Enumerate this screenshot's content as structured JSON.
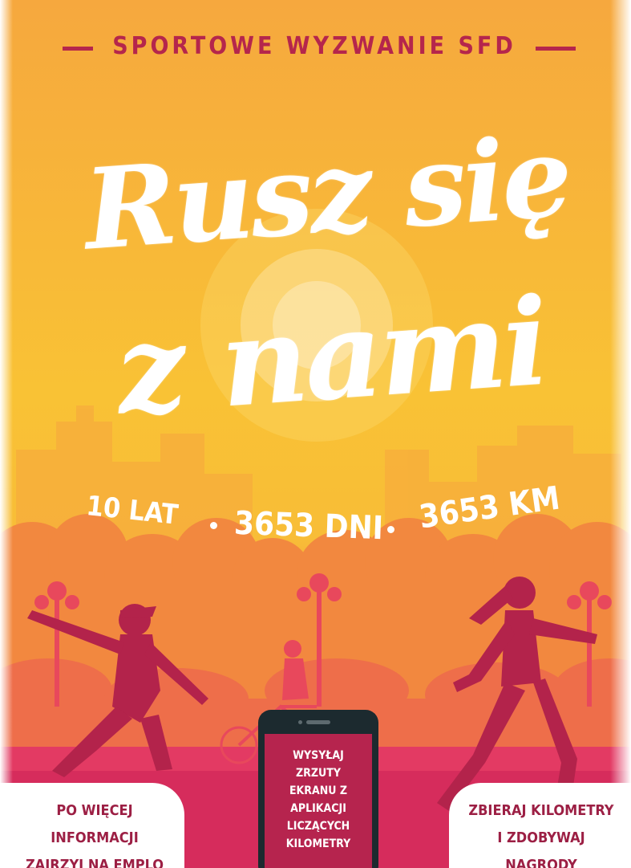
{
  "header": {
    "text": "SPORTOWE WYZWANIE SFD"
  },
  "title": {
    "line1": "Rusz się",
    "line2": "z nami"
  },
  "stats": {
    "years": "10 LAT",
    "days": "3653 DNI",
    "km": "3653 KM"
  },
  "info_left": {
    "line1": "PO WIĘCEJ INFORMACJI",
    "line2": "ZAJRZYJ NA EMPLO"
  },
  "info_right": {
    "line1": "ZBIERAJ KILOMETRY",
    "line2": "I ZDOBYWAJ NAGRODY"
  },
  "phone": {
    "lines": [
      "WYSYŁAJ",
      "ZRZUTY",
      "EKRANU Z",
      "APLIKACJI",
      "LICZĄCYCH",
      "KILOMETRY"
    ]
  },
  "colors": {
    "sky_top": "#f6a83e",
    "sky_mid": "#f9bf34",
    "trees": "#f07e45",
    "ground": "#e23c66",
    "accent": "#b5264c",
    "silhouette": "#b3234b",
    "white": "#ffffff"
  },
  "icons": [
    "sun-icon",
    "city-skyline-icon",
    "tree-icon",
    "street-lamp-icon",
    "skateboarder-icon",
    "cyclist-icon",
    "runner-icon",
    "smartphone-icon"
  ]
}
